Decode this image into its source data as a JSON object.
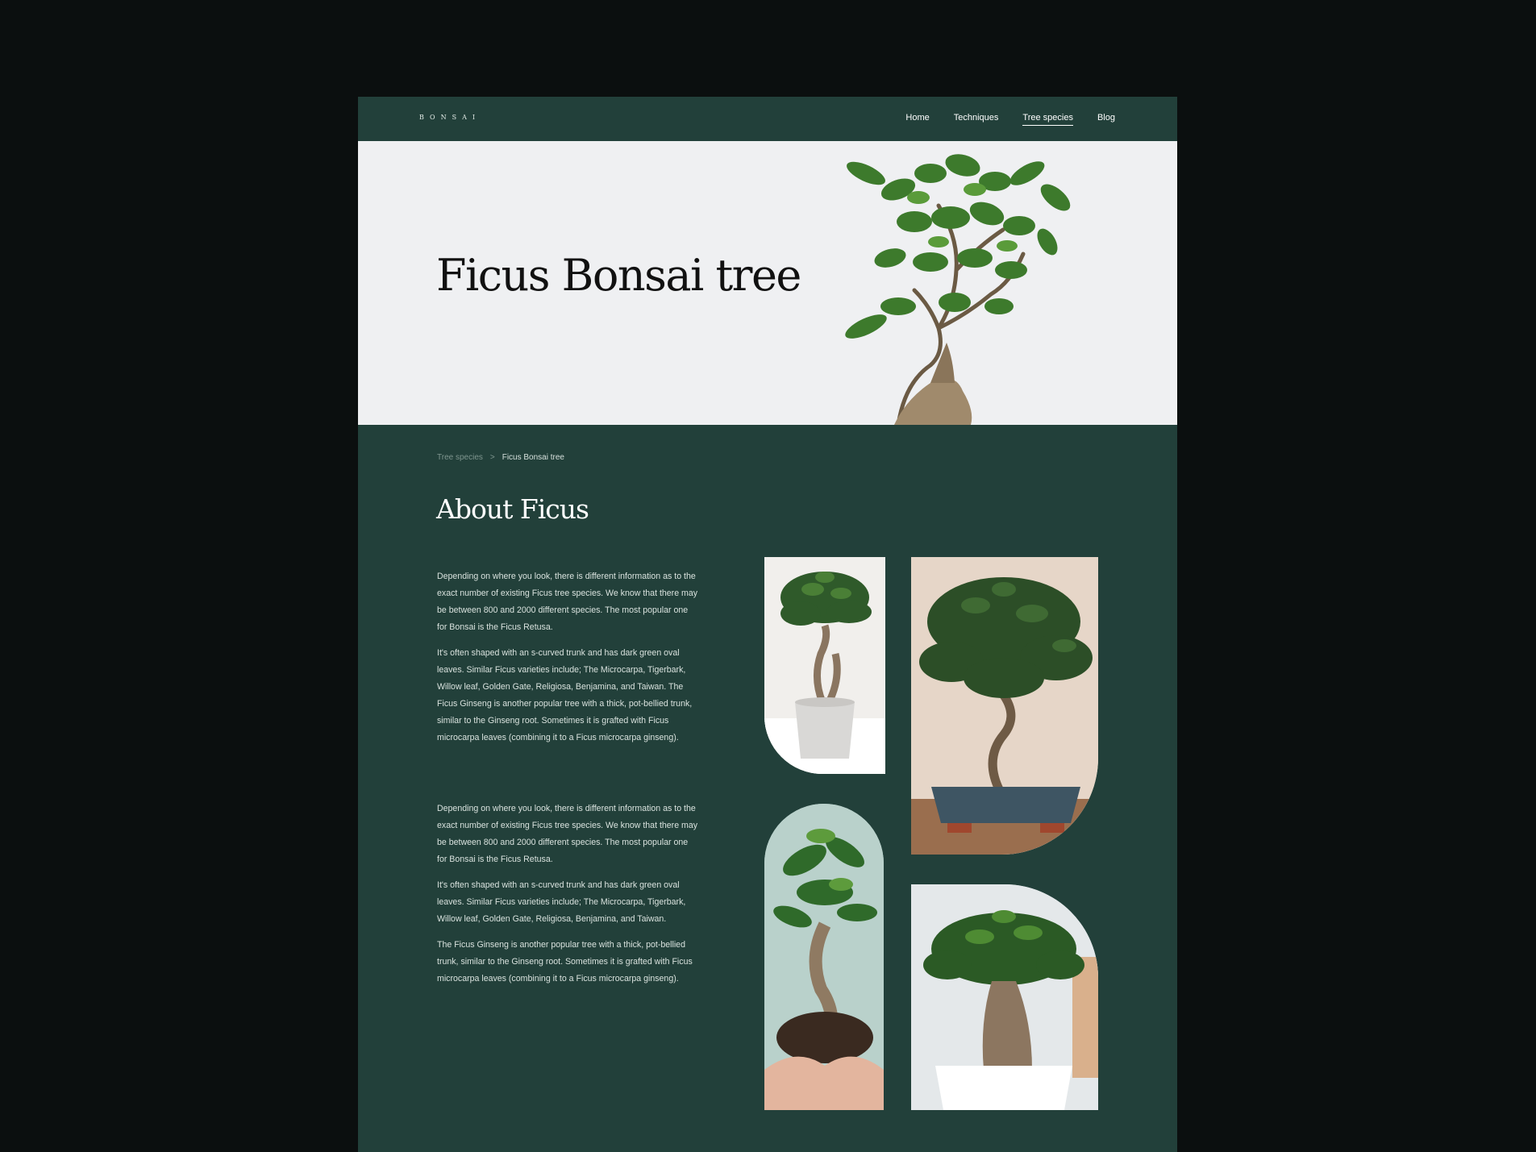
{
  "brand": {
    "logo": "BONSAI"
  },
  "nav": {
    "items": [
      {
        "label": "Home",
        "active": false
      },
      {
        "label": "Techniques",
        "active": false
      },
      {
        "label": "Tree species",
        "active": true
      },
      {
        "label": "Blog",
        "active": false
      }
    ]
  },
  "hero": {
    "title": "Ficus Bonsai tree"
  },
  "breadcrumb": {
    "parent": "Tree species",
    "separator": ">",
    "current": "Ficus Bonsai tree"
  },
  "about": {
    "title": "About Ficus",
    "paragraphs": [
      "Depending on where you look, there is different information as to the exact number of existing Ficus tree species. We know that there may be between 800 and 2000 different species. The most popular one for Bonsai is the Ficus Retusa.",
      "It's often shaped with an s-curved trunk and has dark green oval leaves. Similar Ficus varieties include; The Microcarpa, Tigerbark, Willow leaf, Golden Gate, Religiosa, Benjamina, and Taiwan. The Ficus Ginseng is another popular tree with a thick, pot-bellied trunk, similar to the Ginseng root. Sometimes it is grafted with Ficus microcarpa leaves (combining it to a Ficus microcarpa ginseng).",
      "Depending on where you look, there is different information as to the exact number of existing Ficus tree species. We know that there may be between 800 and 2000 different species. The most popular one for Bonsai is the Ficus Retusa.",
      "It's often shaped with an s-curved trunk and has dark green oval leaves. Similar Ficus varieties include; The Microcarpa, Tigerbark, Willow leaf, Golden Gate, Religiosa, Benjamina, and Taiwan.",
      "The Ficus Ginseng is another popular tree with a thick, pot-bellied trunk, similar to the Ginseng root. Sometimes it is grafted with Ficus microcarpa leaves (combining it to a Ficus microcarpa ginseng)."
    ]
  },
  "colors": {
    "page_bg": "#0b0f0f",
    "brand_green": "#22403a",
    "hero_bg": "#eff0f2",
    "text_light": "#d9e2de"
  }
}
